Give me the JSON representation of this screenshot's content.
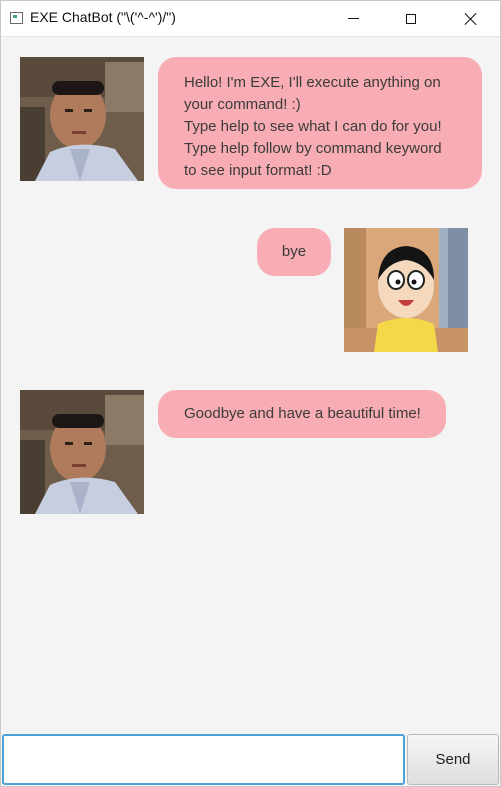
{
  "window": {
    "title": "EXE ChatBot (\"\\('^-^')/\")",
    "controls": [
      "minimize-icon",
      "maximize-icon",
      "close-icon"
    ]
  },
  "dialog": {
    "messages": [
      {
        "sender": "bot",
        "lines": [
          "Hello! I'm EXE, I'll execute anything on",
          "your command! :)",
          "Type help to see what I can do for you!",
          "Type help follow by command keyword",
          "to see input format! :D"
        ]
      },
      {
        "sender": "user",
        "lines": [
          "bye"
        ]
      },
      {
        "sender": "bot",
        "lines": [
          "Goodbye and have a beautiful time!"
        ]
      }
    ]
  },
  "input": {
    "value": "",
    "placeholder": ""
  },
  "send_button": {
    "label": "Send"
  },
  "colors": {
    "bubble": "#f7adb3",
    "background": "#f4f4f4",
    "input_focus_border": "#4ca0d8"
  }
}
